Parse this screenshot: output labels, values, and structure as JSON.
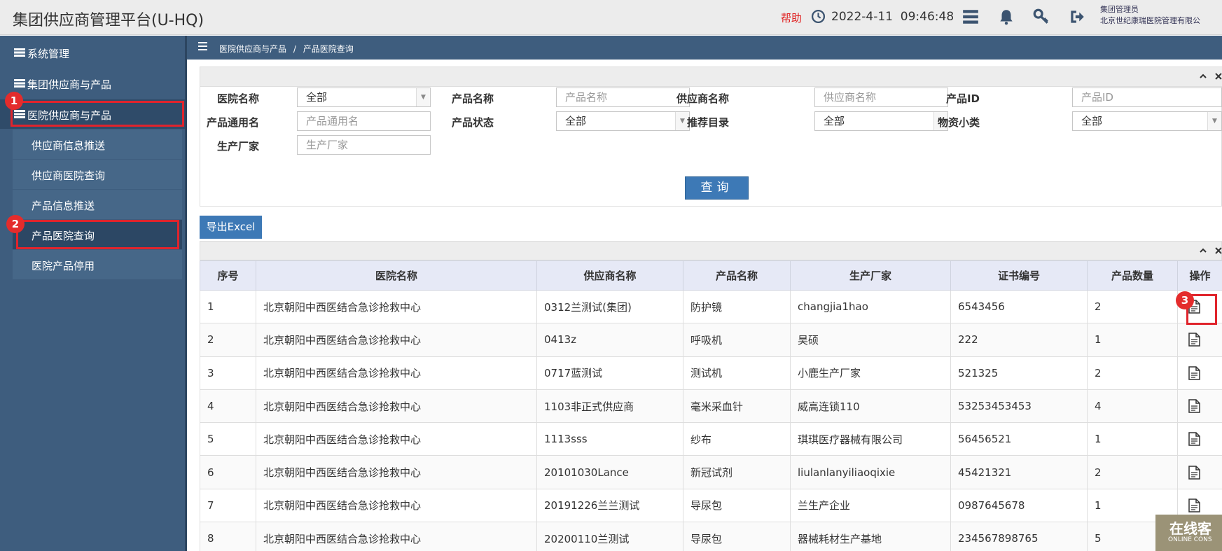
{
  "header": {
    "title": "集团供应商管理平台(U-HQ)",
    "help": "帮助",
    "date": "2022-4-11",
    "time": "09:46:48",
    "user_role": "集团管理员",
    "user_org": "北京世纪康瑞医院管理有限公",
    "icons": [
      "clock-icon",
      "list-icon",
      "bell-icon",
      "key-icon",
      "logout-icon"
    ]
  },
  "sidebar": {
    "items": [
      {
        "label": "系统管理"
      },
      {
        "label": "集团供应商与产品"
      },
      {
        "label": "医院供应商与产品"
      }
    ],
    "subitems": [
      {
        "label": "供应商信息推送"
      },
      {
        "label": "供应商医院查询"
      },
      {
        "label": "产品信息推送"
      },
      {
        "label": "产品医院查询"
      },
      {
        "label": "医院产品停用"
      }
    ],
    "badges": [
      "1",
      "2",
      "3"
    ]
  },
  "breadcrumb": {
    "parent": "医院供应商与产品",
    "separator": "/",
    "current": "产品医院查询"
  },
  "search": {
    "hospital_label": "医院名称",
    "hospital_value": "全部",
    "product_name_label": "产品名称",
    "product_name_placeholder": "产品名称",
    "supplier_label": "供应商名称",
    "supplier_placeholder": "供应商名称",
    "product_id_label": "产品ID",
    "product_id_placeholder": "产品ID",
    "generic_label": "产品通用名",
    "generic_placeholder": "产品通用名",
    "status_label": "产品状态",
    "status_value": "全部",
    "catalog_label": "推荐目录",
    "catalog_value": "全部",
    "category_label": "物资小类",
    "category_value": "全部",
    "maker_label": "生产厂家",
    "maker_placeholder": "生产厂家",
    "query_label": "查询"
  },
  "export_label": "导出Excel",
  "table": {
    "columns": [
      "序号",
      "医院名称",
      "供应商名称",
      "产品名称",
      "生产厂家",
      "证书编号",
      "产品数量",
      "操作"
    ],
    "rows": [
      [
        "1",
        "北京朝阳中西医结合急诊抢救中心",
        "0312兰测试(集团)",
        "防护镜",
        "changjia1hao",
        "6543456",
        "2"
      ],
      [
        "2",
        "北京朝阳中西医结合急诊抢救中心",
        "0413z",
        "呼吸机",
        "昊硕",
        "222",
        "1"
      ],
      [
        "3",
        "北京朝阳中西医结合急诊抢救中心",
        "0717蓝测试",
        "测试机",
        "小鹿生产厂家",
        "521325",
        "2"
      ],
      [
        "4",
        "北京朝阳中西医结合急诊抢救中心",
        "1103非正式供应商",
        "毫米采血针",
        "威高连锁110",
        "53253453453",
        "4"
      ],
      [
        "5",
        "北京朝阳中西医结合急诊抢救中心",
        "1113sss",
        "纱布",
        "琪琪医疗器械有限公司",
        "56456521",
        "1"
      ],
      [
        "6",
        "北京朝阳中西医结合急诊抢救中心",
        "20101030Lance",
        "新冠试剂",
        "liulanlanyiliaoqixie",
        "45421321",
        "2"
      ],
      [
        "7",
        "北京朝阳中西医结合急诊抢救中心",
        "20191226兰兰测试",
        "导尿包",
        "兰生产企业",
        "0987645678",
        "1"
      ],
      [
        "8",
        "北京朝阳中西医结合急诊抢救中心",
        "20200110兰测试",
        "导尿包",
        "器械耗材生产基地",
        "234567898765",
        "5"
      ]
    ]
  },
  "watermark": {
    "main": "在线客",
    "sub": "ONLINE CONS"
  },
  "colors": {
    "sidebar": "#3e5d7e",
    "accent": "#3d79b6",
    "highlight": "#e0242c",
    "help": "#e02020"
  }
}
